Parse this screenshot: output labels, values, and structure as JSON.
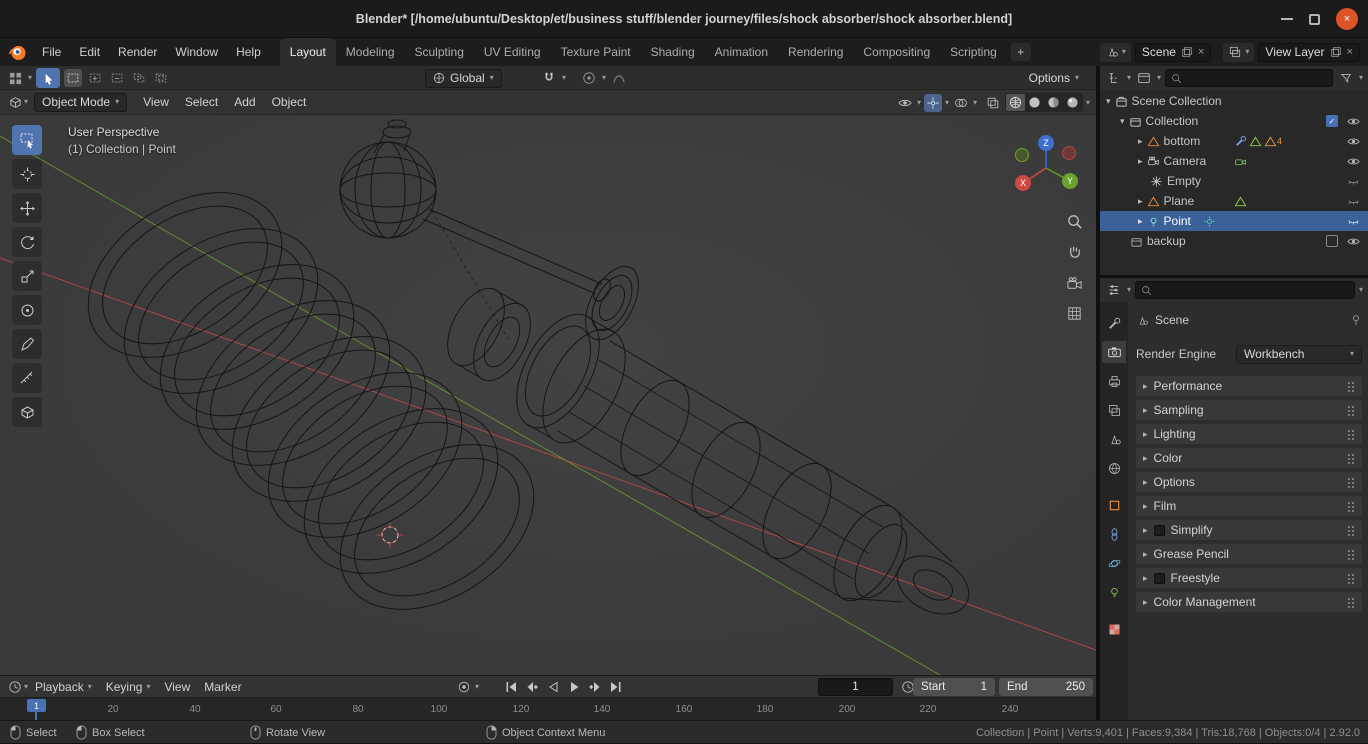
{
  "window": {
    "title": "Blender* [/home/ubuntu/Desktop/et/business stuff/blender journey/files/shock absorber/shock absorber.blend]"
  },
  "icons": {
    "chevron": "▾",
    "tri_right": "▸",
    "tri_down": "▾",
    "close": "×",
    "check": "✓",
    "plus": "+"
  },
  "topbar": {
    "menus": [
      "File",
      "Edit",
      "Render",
      "Window",
      "Help"
    ],
    "tabs": [
      "Layout",
      "Modeling",
      "Sculpting",
      "UV Editing",
      "Texture Paint",
      "Shading",
      "Animation",
      "Rendering",
      "Compositing",
      "Scripting"
    ],
    "active_tab": "Layout",
    "scene_value": "Scene",
    "view_layer_value": "View Layer"
  },
  "tool_settings": {
    "orientation": "Global",
    "options": "Options"
  },
  "viewport": {
    "mode": "Object Mode",
    "menus": [
      "View",
      "Select",
      "Add",
      "Object"
    ],
    "overlay_line1": "User Perspective",
    "overlay_line2": "(1) Collection | Point",
    "axis_x": "X",
    "axis_y": "Y",
    "axis_z": "Z"
  },
  "outliner": {
    "rows": [
      {
        "label": "Scene Collection"
      },
      {
        "label": "Collection"
      },
      {
        "label": "bottom",
        "badge_count": "4"
      },
      {
        "label": "Camera"
      },
      {
        "label": "Empty"
      },
      {
        "label": "Plane"
      },
      {
        "label": "Point"
      },
      {
        "label": "backup"
      }
    ]
  },
  "properties": {
    "breadcrumb": "Scene",
    "render_engine_label": "Render Engine",
    "render_engine_value": "Workbench",
    "sections": [
      "Performance",
      "Sampling",
      "Lighting",
      "Color",
      "Options",
      "Film",
      "Simplify",
      "Grease Pencil",
      "Freestyle",
      "Color Management"
    ]
  },
  "timeline": {
    "menus": [
      "Playback",
      "Keying",
      "View",
      "Marker"
    ],
    "current_frame": "1",
    "start_label": "Start",
    "start_value": "1",
    "end_label": "End",
    "end_value": "250",
    "playhead_label": "1",
    "ticks": [
      "20",
      "40",
      "60",
      "80",
      "100",
      "120",
      "140",
      "160",
      "180",
      "200",
      "220",
      "240"
    ]
  },
  "statusbar": {
    "items": [
      "Select",
      "Box Select",
      "Rotate View",
      "Object Context Menu"
    ],
    "info": "Collection | Point | Verts:9,401 | Faces:9,384 | Tris:18,768 | Objects:0/4 | 2.92.0"
  }
}
